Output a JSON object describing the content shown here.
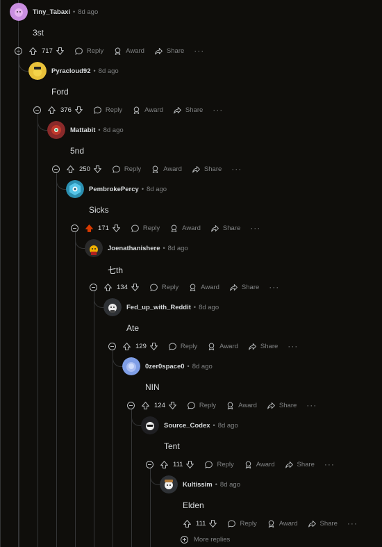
{
  "labels": {
    "reply": "Reply",
    "award": "Award",
    "share": "Share",
    "more": "···"
  },
  "comments": [
    {
      "author": "Tiny_Tabaxi",
      "time": "8d ago",
      "text": "3st",
      "score": "717",
      "upvoted": false,
      "avatar_color": "#c98ee0"
    },
    {
      "author": "Pyracloud92",
      "time": "8d ago",
      "text": "Ford",
      "score": "376",
      "upvoted": false,
      "avatar_color": "#e8c13a"
    },
    {
      "author": "Mattabit",
      "time": "8d ago",
      "text": "5nd",
      "score": "250",
      "upvoted": false,
      "avatar_color": "#8a2a2a"
    },
    {
      "author": "PembrokePercy",
      "time": "8d ago",
      "text": "Sicks",
      "score": "171",
      "upvoted": true,
      "avatar_color": "#2b8fb0"
    },
    {
      "author": "Joenathanishere",
      "time": "8d ago",
      "text": "七th",
      "score": "134",
      "upvoted": false,
      "avatar_color": "#2a2a2a"
    },
    {
      "author": "Fed_up_with_Reddit",
      "time": "8d ago",
      "text": "Ate",
      "score": "129",
      "upvoted": false,
      "avatar_color": "#2f3236"
    },
    {
      "author": "0zer0space0",
      "time": "8d ago",
      "text": "NIN",
      "score": "124",
      "upvoted": false,
      "avatar_color": "#7f9ee6"
    },
    {
      "author": "Source_Codex",
      "time": "8d ago",
      "text": "Tent",
      "score": "111",
      "upvoted": false,
      "avatar_color": "#1f1f22"
    },
    {
      "author": "Kultissim",
      "time": "8d ago",
      "text": "Elden",
      "score": "111",
      "upvoted": false,
      "avatar_color": "#2f3236"
    }
  ],
  "more_replies": "More replies",
  "colors": {
    "background": "#0f0e0b",
    "thread_line": "#343536",
    "upvote_active": "#d93a00",
    "muted_text": "#818384",
    "text": "#d7dadc"
  }
}
